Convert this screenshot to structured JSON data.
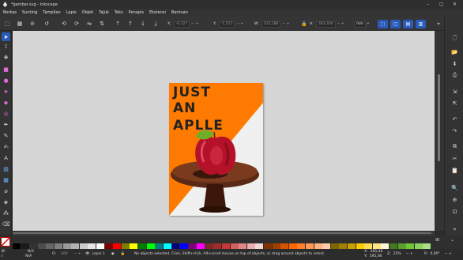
{
  "window": {
    "title": "*gambar.svg - Inkscape",
    "controls": [
      "minimize-icon",
      "maximize-icon",
      "close-icon"
    ]
  },
  "menu": [
    "Berkas",
    "Sunting",
    "Tampilan",
    "Lapis",
    "Objek",
    "Tajuk",
    "Teks",
    "Penapis",
    "Ekstensi",
    "Bantuan"
  ],
  "toolbar": {
    "x_label": "X:",
    "x_value": "-0,127",
    "y_label": "Y:",
    "y_value": "-1,513",
    "w_label": "W:",
    "w_value": "213,188",
    "h_label": "H:",
    "h_value": "303,304",
    "unit": "mm",
    "accent": "#2a5bb8"
  },
  "artwork": {
    "line1": "JUST",
    "line2": "AN",
    "line3": "APLLE",
    "orange": "#ff7a00",
    "light": "#f0f0f0"
  },
  "palette_colors": [
    "#000000",
    "#1a1a1a",
    "#333333",
    "#4d4d4d",
    "#666666",
    "#808080",
    "#999999",
    "#b3b3b3",
    "#cccccc",
    "#e6e6e6",
    "#ffffff",
    "#800000",
    "#ff0000",
    "#808000",
    "#ffff00",
    "#008000",
    "#00ff00",
    "#008080",
    "#00ffff",
    "#000080",
    "#0000ff",
    "#800080",
    "#ff00ff",
    "#7f2a2a",
    "#a02c2c",
    "#c83737",
    "#d35f5f",
    "#de8787",
    "#e9afaf",
    "#f4d7d7",
    "#803300",
    "#a04000",
    "#d45500",
    "#ff6600",
    "#ff7f2a",
    "#ff9955",
    "#ffb380",
    "#ffccaa",
    "#806600",
    "#a08000",
    "#c8a000",
    "#ffcc00",
    "#ffdd55",
    "#ffe680",
    "#fff6d5",
    "#447821",
    "#5aa02c",
    "#71c837",
    "#8dd35f",
    "#aade87"
  ],
  "status": {
    "fill_label": "Ø:",
    "fill_value": "N/A",
    "stroke_label": "⁄:",
    "stroke_value": "N/A",
    "opacity_label": "O:",
    "opacity_value": "100",
    "layer": "Lapis 1",
    "message": "No objects selected. Click, Shift+click, Alt+scroll mouse on top of objects, or drag around objects to select.",
    "coord_x_label": "X:",
    "coord_x": "285,48",
    "coord_y_label": "Y:",
    "coord_y": "195,06",
    "zoom_label": "Z:",
    "zoom": "25%",
    "rotation_label": "R:",
    "rotation": "0,00°"
  }
}
